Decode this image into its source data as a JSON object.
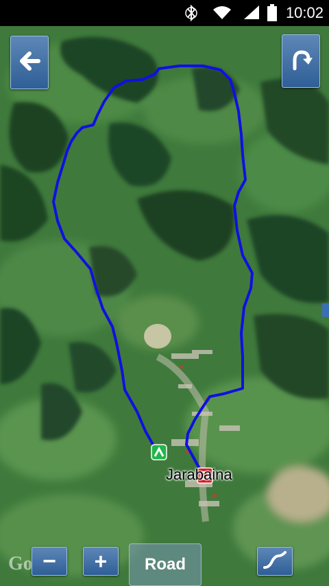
{
  "status_bar": {
    "time": "10:02",
    "icons": [
      "bluetooth-icon",
      "wifi-icon",
      "signal-icon",
      "battery-icon"
    ]
  },
  "toolbar": {
    "back_icon": "arrow-left-icon",
    "redo_icon": "curved-arrow-icon"
  },
  "map": {
    "place_label": "Jaraba‌ina",
    "route_color": "#1010e0",
    "start_marker_color": "#22b54a",
    "end_marker_color": "#d2141c",
    "attribution": "Google"
  },
  "controls": {
    "zoom_out_label": "−",
    "zoom_in_label": "+",
    "map_type_label": "Road",
    "elevation_icon": "elevation-profile-icon"
  }
}
